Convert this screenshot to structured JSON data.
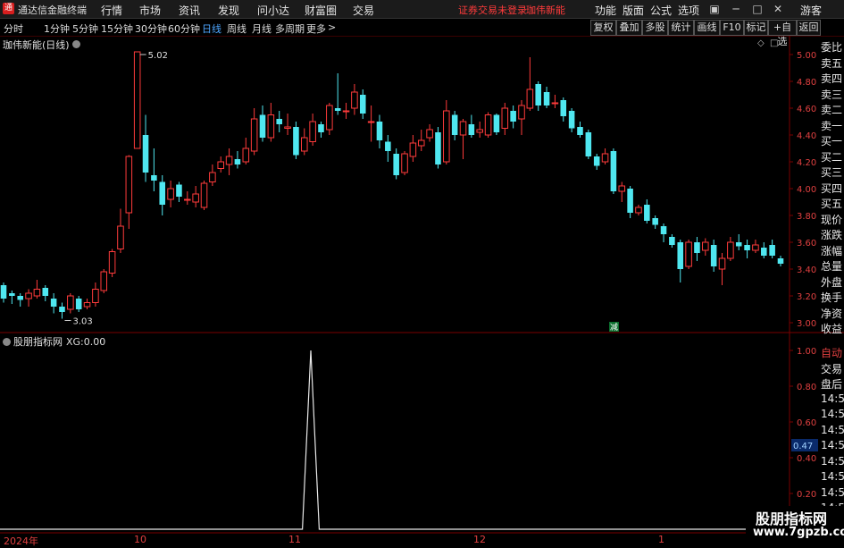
{
  "app": {
    "title": "通达信金融终端",
    "menus": [
      "行情",
      "市场",
      "资讯",
      "发现",
      "问小达",
      "财富圈",
      "交易"
    ],
    "warning": "证券交易未登录",
    "stock_name": "珈伟新能",
    "right_menus": [
      "功能",
      "版面",
      "公式",
      "选项"
    ],
    "user": "游客"
  },
  "toolbar": {
    "periods": [
      "分时",
      "1分钟",
      "5分钟",
      "15分钟",
      "30分钟",
      "60分钟",
      "日线",
      "周线",
      "月线",
      "多周期",
      "更多"
    ],
    "active_period": "日线",
    "more_arrow": ">",
    "buttons": [
      "复权",
      "叠加",
      "多股",
      "统计",
      "画线",
      "F10",
      "标记",
      "+自选",
      "返回"
    ]
  },
  "main_chart": {
    "header": "珈伟新能(日线)",
    "high_label": "5.02",
    "low_label": "3.03",
    "marker_label": "减",
    "y_ticks": [
      "5.00",
      "4.80",
      "4.60",
      "4.40",
      "4.20",
      "4.00",
      "3.80",
      "3.60",
      "3.40",
      "3.20",
      "3.00"
    ]
  },
  "sub_chart": {
    "indicator": "股朋指标网",
    "series_label": "XG:",
    "series_value": "0.00",
    "y_ticks": [
      "1.00",
      "0.80",
      "0.60",
      "0.40",
      "0.20"
    ],
    "cursor_value": "0.47"
  },
  "x_axis": {
    "labels": [
      "2024年",
      "10",
      "11",
      "12",
      "1"
    ]
  },
  "right_panel": {
    "labels": [
      "委比",
      "卖五",
      "卖四",
      "卖三",
      "卖二",
      "卖一",
      "买一",
      "买二",
      "买三",
      "买四",
      "买五",
      "现价",
      "涨跌",
      "涨幅",
      "总量",
      "外盘",
      "换手",
      "净资",
      "收益",
      "自动",
      "交易",
      "盘后",
      "14:56",
      "14:56",
      "14:56",
      "14:56",
      "14:56",
      "14:56",
      "14:56",
      "14:56"
    ]
  },
  "watermark": {
    "line1": "股朋指标网",
    "line2": "www.7gpzb.com"
  },
  "colors": {
    "up": "#ff3b3b",
    "down": "#4fe7f0",
    "grid": "#7a0000",
    "axis_text": "#e04040",
    "active": "#4ea6ff"
  },
  "chart_data": [
    {
      "type": "candlestick",
      "title": "珈伟新能(日线)",
      "ylim": [
        2.95,
        5.05
      ],
      "x": [
        "2024-09",
        "2024-10",
        "2024-11",
        "2024-12",
        "2025-01"
      ],
      "ohlc": [
        [
          3.28,
          3.18,
          3.3,
          3.15
        ],
        [
          3.22,
          3.2,
          3.24,
          3.14
        ],
        [
          3.2,
          3.17,
          3.22,
          3.12
        ],
        [
          3.18,
          3.22,
          3.25,
          3.12
        ],
        [
          3.2,
          3.25,
          3.32,
          3.18
        ],
        [
          3.26,
          3.2,
          3.28,
          3.16
        ],
        [
          3.18,
          3.12,
          3.22,
          3.07
        ],
        [
          3.12,
          3.08,
          3.15,
          3.03
        ],
        [
          3.1,
          3.2,
          3.22,
          3.07
        ],
        [
          3.18,
          3.1,
          3.2,
          3.08
        ],
        [
          3.12,
          3.15,
          3.18,
          3.1
        ],
        [
          3.15,
          3.25,
          3.3,
          3.12
        ],
        [
          3.24,
          3.38,
          3.4,
          3.22
        ],
        [
          3.37,
          3.53,
          3.55,
          3.34
        ],
        [
          3.55,
          3.72,
          3.85,
          3.52
        ],
        [
          3.82,
          4.24,
          4.25,
          3.7
        ],
        [
          4.3,
          5.02,
          5.02,
          4.3
        ],
        [
          4.4,
          4.12,
          4.55,
          4.05
        ],
        [
          4.1,
          4.06,
          4.3,
          3.98
        ],
        [
          4.05,
          3.88,
          4.1,
          3.8
        ],
        [
          3.92,
          4.0,
          4.06,
          3.86
        ],
        [
          4.03,
          3.94,
          4.05,
          3.9
        ],
        [
          3.92,
          3.92,
          3.98,
          3.88
        ],
        [
          3.9,
          3.96,
          4.02,
          3.86
        ],
        [
          3.86,
          4.04,
          4.06,
          3.84
        ],
        [
          4.05,
          4.12,
          4.18,
          4.02
        ],
        [
          4.15,
          4.2,
          4.24,
          4.12
        ],
        [
          4.18,
          4.24,
          4.3,
          4.1
        ],
        [
          4.22,
          4.18,
          4.28,
          4.15
        ],
        [
          4.2,
          4.3,
          4.38,
          4.18
        ],
        [
          4.28,
          4.52,
          4.6,
          4.25
        ],
        [
          4.55,
          4.38,
          4.62,
          4.35
        ],
        [
          4.38,
          4.55,
          4.64,
          4.35
        ],
        [
          4.52,
          4.48,
          4.58,
          4.42
        ],
        [
          4.45,
          4.46,
          4.56,
          4.4
        ],
        [
          4.46,
          4.25,
          4.5,
          4.22
        ],
        [
          4.28,
          4.38,
          4.45,
          4.25
        ],
        [
          4.35,
          4.5,
          4.56,
          4.32
        ],
        [
          4.48,
          4.42,
          4.5,
          4.38
        ],
        [
          4.44,
          4.62,
          4.64,
          4.4
        ],
        [
          4.6,
          4.58,
          4.86,
          4.55
        ],
        [
          4.58,
          4.58,
          4.64,
          4.52
        ],
        [
          4.6,
          4.72,
          4.78,
          4.55
        ],
        [
          4.7,
          4.56,
          4.74,
          4.52
        ],
        [
          4.5,
          4.5,
          4.62,
          4.35
        ],
        [
          4.5,
          4.36,
          4.55,
          4.3
        ],
        [
          4.35,
          4.28,
          4.4,
          4.2
        ],
        [
          4.26,
          4.1,
          4.3,
          4.07
        ],
        [
          4.12,
          4.26,
          4.28,
          4.1
        ],
        [
          4.24,
          4.34,
          4.4,
          4.2
        ],
        [
          4.32,
          4.36,
          4.44,
          4.28
        ],
        [
          4.38,
          4.44,
          4.48,
          4.35
        ],
        [
          4.42,
          4.18,
          4.46,
          4.15
        ],
        [
          4.2,
          4.58,
          4.66,
          4.18
        ],
        [
          4.55,
          4.4,
          4.58,
          4.36
        ],
        [
          4.4,
          4.5,
          4.52,
          4.22
        ],
        [
          4.48,
          4.4,
          4.55,
          4.38
        ],
        [
          4.42,
          4.44,
          4.5,
          4.38
        ],
        [
          4.4,
          4.55,
          4.57,
          4.38
        ],
        [
          4.55,
          4.42,
          4.56,
          4.4
        ],
        [
          4.45,
          4.6,
          4.64,
          4.4
        ],
        [
          4.58,
          4.5,
          4.62,
          4.45
        ],
        [
          4.52,
          4.62,
          4.66,
          4.4
        ],
        [
          4.6,
          4.74,
          4.98,
          4.58
        ],
        [
          4.78,
          4.62,
          4.8,
          4.58
        ],
        [
          4.72,
          4.62,
          4.76,
          4.6
        ],
        [
          4.64,
          4.64,
          4.7,
          4.6
        ],
        [
          4.66,
          4.54,
          4.68,
          4.5
        ],
        [
          4.58,
          4.45,
          4.6,
          4.42
        ],
        [
          4.46,
          4.4,
          4.5,
          4.38
        ],
        [
          4.42,
          4.24,
          4.44,
          4.22
        ],
        [
          4.24,
          4.17,
          4.26,
          4.14
        ],
        [
          4.2,
          4.26,
          4.3,
          4.18
        ],
        [
          4.28,
          3.98,
          4.3,
          3.96
        ],
        [
          3.98,
          4.02,
          4.05,
          3.9
        ],
        [
          4.0,
          3.82,
          4.02,
          3.78
        ],
        [
          3.82,
          3.86,
          3.88,
          3.8
        ],
        [
          3.88,
          3.76,
          3.92,
          3.74
        ],
        [
          3.78,
          3.73,
          3.8,
          3.7
        ],
        [
          3.72,
          3.66,
          3.74,
          3.6
        ],
        [
          3.64,
          3.58,
          3.66,
          3.56
        ],
        [
          3.6,
          3.4,
          3.62,
          3.3
        ],
        [
          3.42,
          3.6,
          3.62,
          3.4
        ],
        [
          3.6,
          3.52,
          3.64,
          3.46
        ],
        [
          3.54,
          3.6,
          3.63,
          3.5
        ],
        [
          3.58,
          3.42,
          3.62,
          3.38
        ],
        [
          3.4,
          3.48,
          3.52,
          3.28
        ],
        [
          3.48,
          3.6,
          3.64,
          3.46
        ],
        [
          3.6,
          3.57,
          3.66,
          3.54
        ],
        [
          3.58,
          3.54,
          3.62,
          3.48
        ],
        [
          3.54,
          3.58,
          3.62,
          3.52
        ],
        [
          3.56,
          3.5,
          3.6,
          3.48
        ],
        [
          3.58,
          3.5,
          3.62,
          3.48
        ],
        [
          3.48,
          3.44,
          3.5,
          3.42
        ]
      ]
    },
    {
      "type": "line",
      "title": "股朋指标网",
      "series": [
        {
          "name": "XG",
          "values": [
            0,
            0,
            0,
            0,
            0,
            0,
            0,
            0,
            0,
            0,
            0,
            0,
            0,
            0,
            0,
            0,
            0,
            0,
            0,
            0,
            0,
            0,
            0,
            0,
            0,
            0,
            0,
            0,
            0,
            0,
            0,
            0,
            0,
            0,
            0,
            0,
            0,
            0,
            0,
            0,
            0,
            0,
            0,
            0,
            0,
            0,
            0,
            0,
            0,
            0,
            0,
            0,
            0,
            0,
            0,
            0,
            0,
            0,
            0,
            0,
            0,
            0,
            0,
            0,
            0,
            0,
            0,
            0,
            0,
            0,
            0,
            0,
            0,
            0,
            0,
            0,
            0,
            0,
            0,
            0,
            0,
            0,
            0,
            0,
            0,
            0,
            0,
            0,
            0,
            0,
            0,
            0,
            0,
            0,
            0
          ]
        }
      ],
      "spike_at_index": 37,
      "spike_value": 1.0,
      "ylim": [
        0,
        1.0
      ]
    }
  ]
}
